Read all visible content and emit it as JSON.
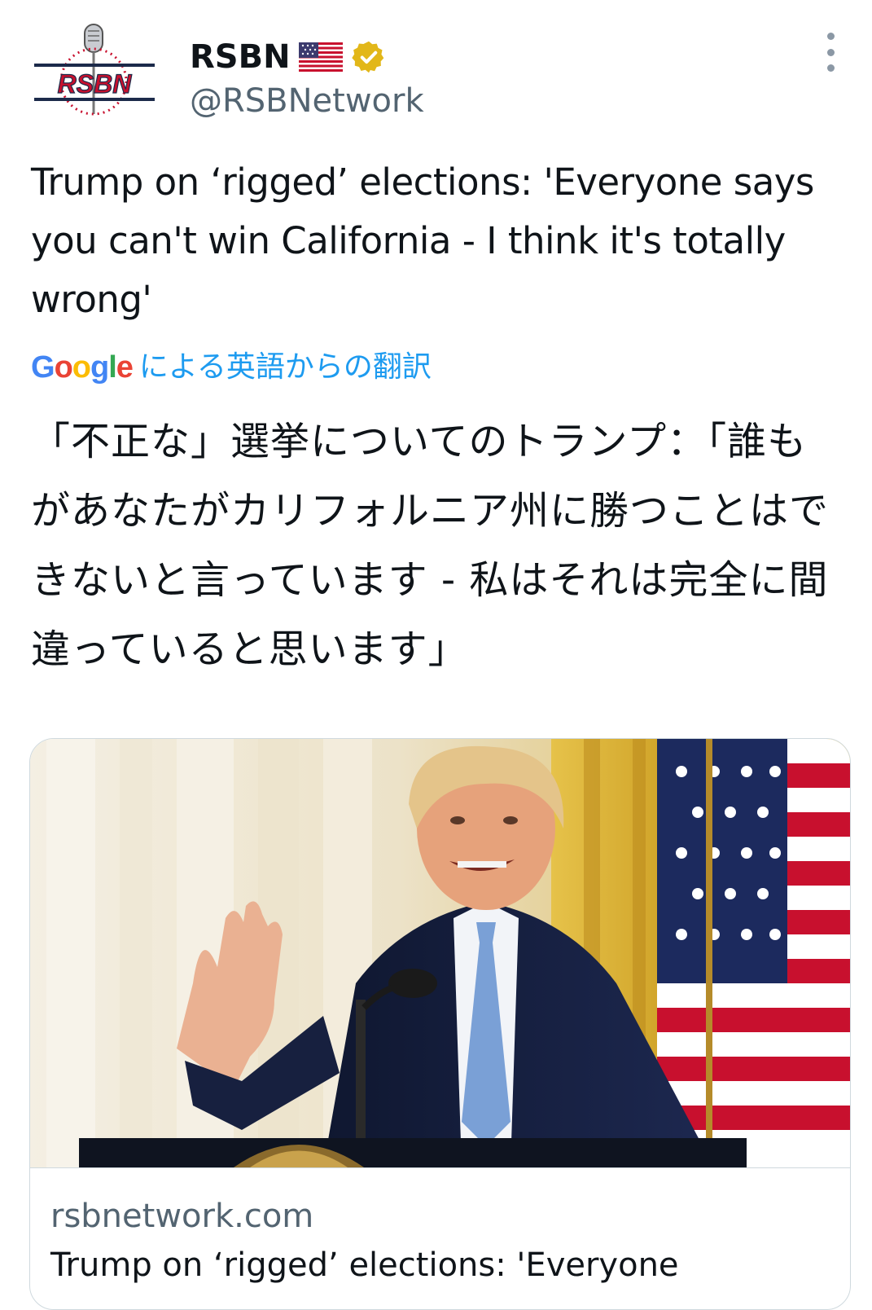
{
  "tweet": {
    "author": {
      "display_name": "RSBN",
      "flag": "US-flag-emoji",
      "verified": "verified-gold-badge",
      "handle": "@RSBNetwork",
      "avatar_text": "RSBN"
    },
    "text": "Trump on ‘rigged’ elections: 'Everyone says you can't win California - I think it's totally wrong'",
    "translation": {
      "provider": "Google",
      "label": "による英語からの翻訳",
      "text": "「不正な」選挙についてのトランプ：「誰もがあなたがカリフォルニア州に勝つことはできないと言っています - 私はそれは完全に間違っていると思います」"
    },
    "card": {
      "domain": "rsbnetwork.com",
      "title_partial": "Trump on ‘rigged’ elections: 'Everyone"
    }
  },
  "colors": {
    "text_primary": "#0f1419",
    "text_secondary": "#536471",
    "link_blue": "#1d9bf0",
    "border": "#cfd9de",
    "verified_gold": "#e2b719"
  },
  "icons": {
    "more": "more-vertical-icon",
    "verified": "verified-badge-icon"
  }
}
